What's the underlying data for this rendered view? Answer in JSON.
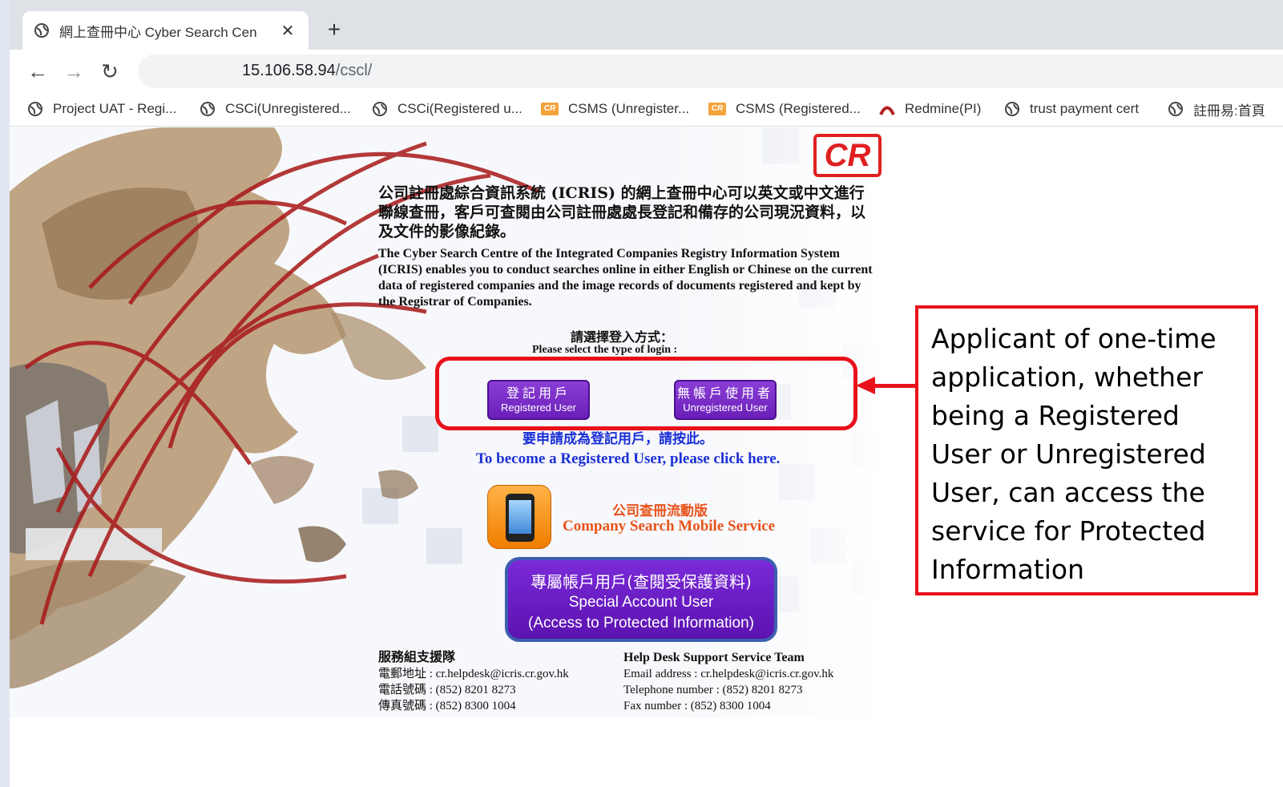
{
  "browser": {
    "tab": {
      "title": "網上查冊中心 Cyber Search Cen",
      "close": "✕"
    },
    "new_tab": "+",
    "nav": {
      "back": "←",
      "forward": "→",
      "reload": "↻"
    },
    "url": {
      "host": "15.106.58.94",
      "path": "/cscl/"
    },
    "bookmarks": [
      {
        "label": "Project UAT - Regi...",
        "icon": "globe-icon"
      },
      {
        "label": "CSCi(Unregistered...",
        "icon": "globe-icon"
      },
      {
        "label": "CSCi(Registered u...",
        "icon": "globe-icon"
      },
      {
        "label": "CSMS (Unregister...",
        "icon": "cr-icon"
      },
      {
        "label": "CSMS (Registered...",
        "icon": "cr-icon"
      },
      {
        "label": "Redmine(PI)",
        "icon": "redmine-icon"
      },
      {
        "label": "trust payment cert",
        "icon": "globe-icon"
      },
      {
        "label": "註冊易:首頁",
        "icon": "globe-icon"
      }
    ]
  },
  "page": {
    "logo": "CR",
    "intro_zh": "公司註冊處綜合資訊系統 (ICRIS) 的網上查冊中心可以英文或中文進行聯線查冊，客戶可查閱由公司註冊處處長登記和備存的公司現況資料，以及文件的影像紀錄。",
    "intro_en": "The Cyber Search Centre of the Integrated Companies Registry Information System (ICRIS) enables you to conduct searches online in either English or Chinese on the current data of registered companies and the image records of documents registered and kept by the Registrar of Companies.",
    "select_zh": "請選擇登入方式：",
    "select_en": "Please select the type of login :",
    "registered_btn": {
      "zh": "登記用戶",
      "en": "Registered User"
    },
    "unregistered_btn": {
      "zh": "無帳戶使用者",
      "en": "Unregistered User"
    },
    "become_zh": "要申請成為登記用戶，請按此。",
    "become_en": "To become a Registered User, please click here.",
    "mobile_zh": "公司查冊流動版",
    "mobile_en": "Company Search Mobile Service",
    "special": {
      "line1": "專屬帳戶用戶(查閱受保護資料)",
      "line2": "Special Account User",
      "line3": "(Access to Protected Information)"
    },
    "help_zh": {
      "title": "服務組支援隊",
      "email": "電郵地址 : cr.helpdesk@icris.cr.gov.hk",
      "phone": "電話號碼 : (852) 8201 8273",
      "fax": "傳真號碼 : (852) 8300 1004"
    },
    "help_en": {
      "title": "Help Desk Support Service Team",
      "email": "Email address : cr.helpdesk@icris.cr.gov.hk",
      "phone": "Telephone number : (852) 8201 8273",
      "fax": "Fax number : (852) 8300 1004"
    }
  },
  "annotation": {
    "text": "Applicant of one-time application, whether being a Registered User or Unregistered User, can access the service for Protected Information",
    "color": "#e8111a"
  }
}
